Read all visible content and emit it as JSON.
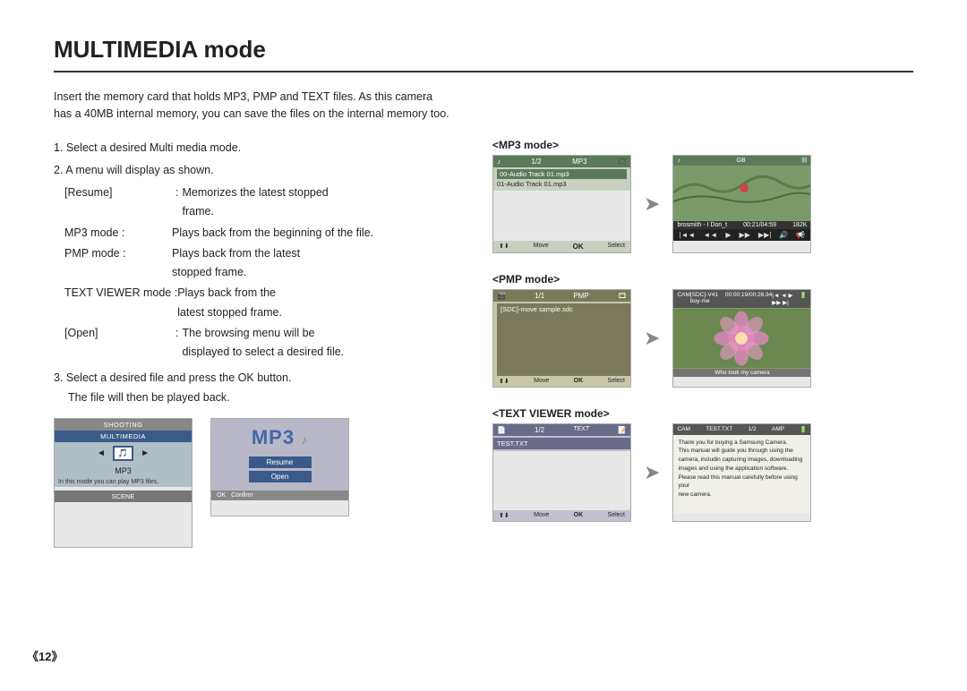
{
  "title": "MULTIMEDIA mode",
  "intro": {
    "line1": "Insert the memory card that holds MP3, PMP and TEXT files. As this camera",
    "line2": "has a 40MB internal memory, you can save the files on the internal memory too."
  },
  "steps": {
    "step1": "1. Select a desired Multi media mode.",
    "step2": "2. A menu will display as shown.",
    "resume_label": "[Resume]",
    "resume_colon": ":",
    "resume_desc1": "Memorizes the latest stopped",
    "resume_desc2": "frame.",
    "mp3_label": "MP3 mode :",
    "mp3_desc": "Plays back from the beginning of the file.",
    "pmp_label": "PMP mode :",
    "pmp_desc1": "Plays back from the latest",
    "pmp_desc2": "stopped frame.",
    "text_label": "TEXT VIEWER mode :",
    "text_desc1": "Plays back from the",
    "text_desc2": "latest stopped frame.",
    "open_label": "[Open]",
    "open_colon": ":",
    "open_desc1": "The browsing menu will be",
    "open_desc2": "displayed to select a desired file.",
    "step3a": "3. Select a desired file and press the OK button.",
    "step3b": "The file will then be played back."
  },
  "mp3_mode_label": "<MP3 mode>",
  "pmp_mode_label": "<PMP mode>",
  "text_mode_label": "<TEXT VIEWER mode>",
  "screens": {
    "mp3_list": {
      "counter": "1/2",
      "badge": "MP3",
      "track1": "00-Audio Track 01.mp3",
      "track2": "01-Audio Track 01.mp3",
      "move": "Move",
      "select": "Select"
    },
    "mp3_play": {
      "artist": "brosmith - I Don_t",
      "time": "00:21/04:59",
      "bitrate": "182K"
    },
    "menu": {
      "shooting": "SHOOTING",
      "multimedia": "MULTIMEDIA",
      "mp3_label": "MP3",
      "info": "In this mode you can play MP3 files.",
      "scene": "SCENE"
    },
    "mp3logo": {
      "big_label": "MP3",
      "resume": "Resume",
      "open": "Open",
      "ok": "OK",
      "confirm": "Confirm"
    },
    "pmp_list": {
      "counter": "1/1",
      "badge": "PMP",
      "track1": "[SDC]-move sample.sdc",
      "move": "Move",
      "select": "Select"
    },
    "pmp_play": {
      "title": "[SDC]-V41 boy-me",
      "time": "00:00:19/00:26:34",
      "caption": "Who took my camera"
    },
    "text_list": {
      "counter": "1/2",
      "badge": "TEXT",
      "track1": "TEST.TXT",
      "move": "Move",
      "select": "Select"
    },
    "text_view": {
      "filename": "TEST.TXT",
      "counter": "1/2",
      "badge": "AMP",
      "body_line1": "Thank you for buying a Samsung Camera.",
      "body_line2": "This manual will guide you through using the",
      "body_line3": "camera, includin capturing images, downloading",
      "body_line4": "images and using the application software.",
      "body_line5": "Please read this manual carefully before using your",
      "body_line6": "new camera."
    }
  },
  "page_number": "《12》"
}
